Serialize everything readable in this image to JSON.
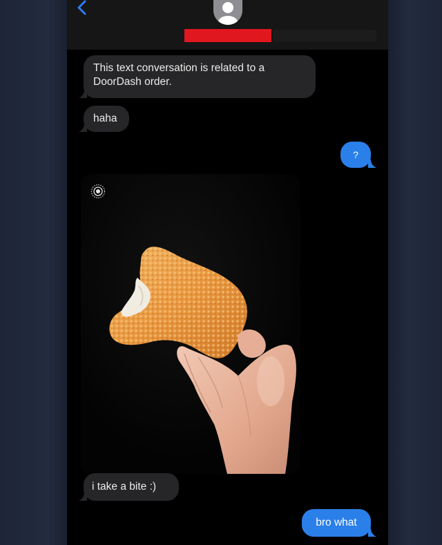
{
  "header": {
    "back_icon": "chevron-left-icon",
    "avatar_icon": "person-silhouette-icon"
  },
  "messages": [
    {
      "direction": "incoming",
      "text": "This text conversation is related to a DoorDash order."
    },
    {
      "direction": "incoming",
      "text": "haha"
    },
    {
      "direction": "outgoing",
      "text": "?"
    },
    {
      "direction": "incoming",
      "type": "photo",
      "icon": "live-photo-icon"
    },
    {
      "direction": "incoming",
      "text": "i take a bite :)"
    },
    {
      "direction": "outgoing",
      "text": "bro what"
    }
  ],
  "colors": {
    "outgoing_bubble": "#2b7fe8",
    "incoming_bubble": "#262628",
    "redaction": "#e0171f"
  }
}
